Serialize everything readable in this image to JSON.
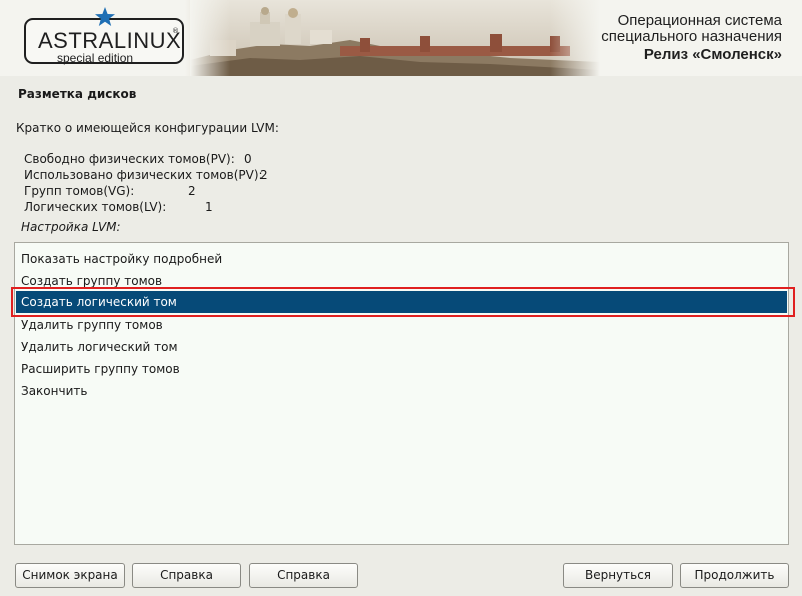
{
  "header": {
    "logo_text": "ASTRALINUX",
    "logo_reg": "®",
    "logo_subtitle": "special edition",
    "os_line1": "Операционная система",
    "os_line2": "специального назначения",
    "os_release": "Релиз «Смоленск»"
  },
  "page": {
    "title": "Разметка дисков",
    "intro": "Кратко о имеющейся конфигурации LVM:",
    "lvm_label": "Настройка LVM:"
  },
  "stats": [
    {
      "label": "Свободно физических томов(PV):",
      "value": "0"
    },
    {
      "label": "Использовано физических томов(PV):",
      "value": "2"
    },
    {
      "label": "Групп томов(VG):",
      "value": "2"
    },
    {
      "label": "Логических томов(LV):",
      "value": "1"
    }
  ],
  "menu": {
    "items": [
      "Показать настройку подробней",
      "Создать группу томов",
      "Создать логический том",
      "Удалить группу томов",
      "Удалить логический том",
      "Расширить группу томов",
      "Закончить"
    ],
    "selected": "Создать логический том"
  },
  "buttons": {
    "screenshot": "Снимок экрана",
    "help1": "Справка",
    "help2": "Справка",
    "back": "Вернуться",
    "continue": "Продолжить"
  },
  "colors": {
    "selection": "#064a78",
    "highlight_frame": "#e02020",
    "background": "#ecece6",
    "list_background": "#f7fbf6"
  }
}
